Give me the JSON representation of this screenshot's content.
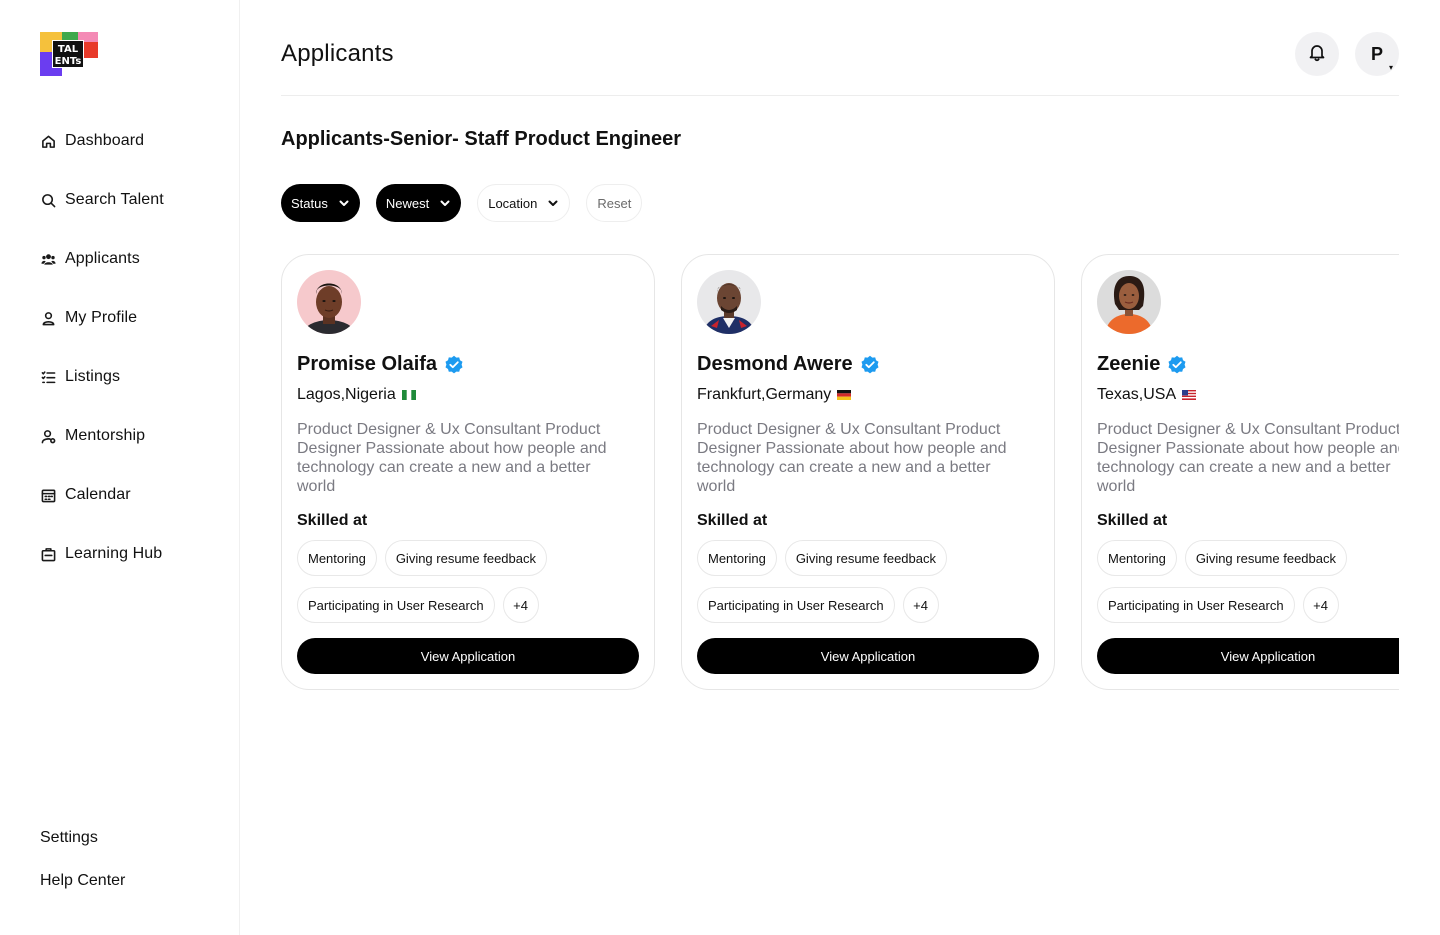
{
  "sidebar": {
    "logo_text": "TALENTS",
    "items": [
      {
        "label": "Dashboard",
        "icon": "home-icon"
      },
      {
        "label": "Search Talent",
        "icon": "search-icon"
      },
      {
        "label": "Applicants",
        "icon": "users-icon",
        "active": true
      },
      {
        "label": "My Profile",
        "icon": "user-icon"
      },
      {
        "label": "Listings",
        "icon": "list-icon"
      },
      {
        "label": "Mentorship",
        "icon": "mentorship-icon"
      },
      {
        "label": "Calendar",
        "icon": "calendar-icon"
      },
      {
        "label": "Learning Hub",
        "icon": "briefcase-icon"
      }
    ],
    "bottom": {
      "settings": "Settings",
      "help": "Help Center"
    }
  },
  "header": {
    "title": "Applicants",
    "avatar_initial": "P"
  },
  "main": {
    "job_title": "Applicants-Senior- Staff Product Engineer",
    "filters": {
      "status": "Status",
      "sort": "Newest",
      "location": "Location",
      "reset": "Reset"
    },
    "skilled_label": "Skilled at",
    "view_button": "View Application",
    "applicants": [
      {
        "name": "Promise Olaifa",
        "location": "Lagos,Nigeria",
        "flag": "nigeria-flag-icon",
        "bio": "Product Designer & Ux Consultant Product Designer Passionate about how people and technology can create a new and a better world",
        "skills": [
          "Mentoring",
          "Giving resume feedback",
          "Participating in User Research"
        ],
        "more": "+4"
      },
      {
        "name": "Desmond Awere",
        "location": "Frankfurt,Germany",
        "flag": "germany-flag-icon",
        "bio": "Product Designer & Ux Consultant Product Designer Passionate about how people and technology can create a new and a better world",
        "skills": [
          "Mentoring",
          "Giving resume feedback",
          "Participating in User Research"
        ],
        "more": "+4"
      },
      {
        "name": "Zeenie",
        "location": "Texas,USA",
        "flag": "usa-flag-icon",
        "bio": "Product Designer & Ux Consultant Product Designer Passionate about how people and technology can create a new and a better world",
        "skills": [
          "Mentoring",
          "Giving resume feedback",
          "Participating in User Research"
        ],
        "more": "+4"
      }
    ]
  },
  "colors": {
    "primary": "#000000",
    "verified": "#1d9bf0",
    "muted_text": "#7a7a82",
    "border": "#e6e6e6"
  }
}
